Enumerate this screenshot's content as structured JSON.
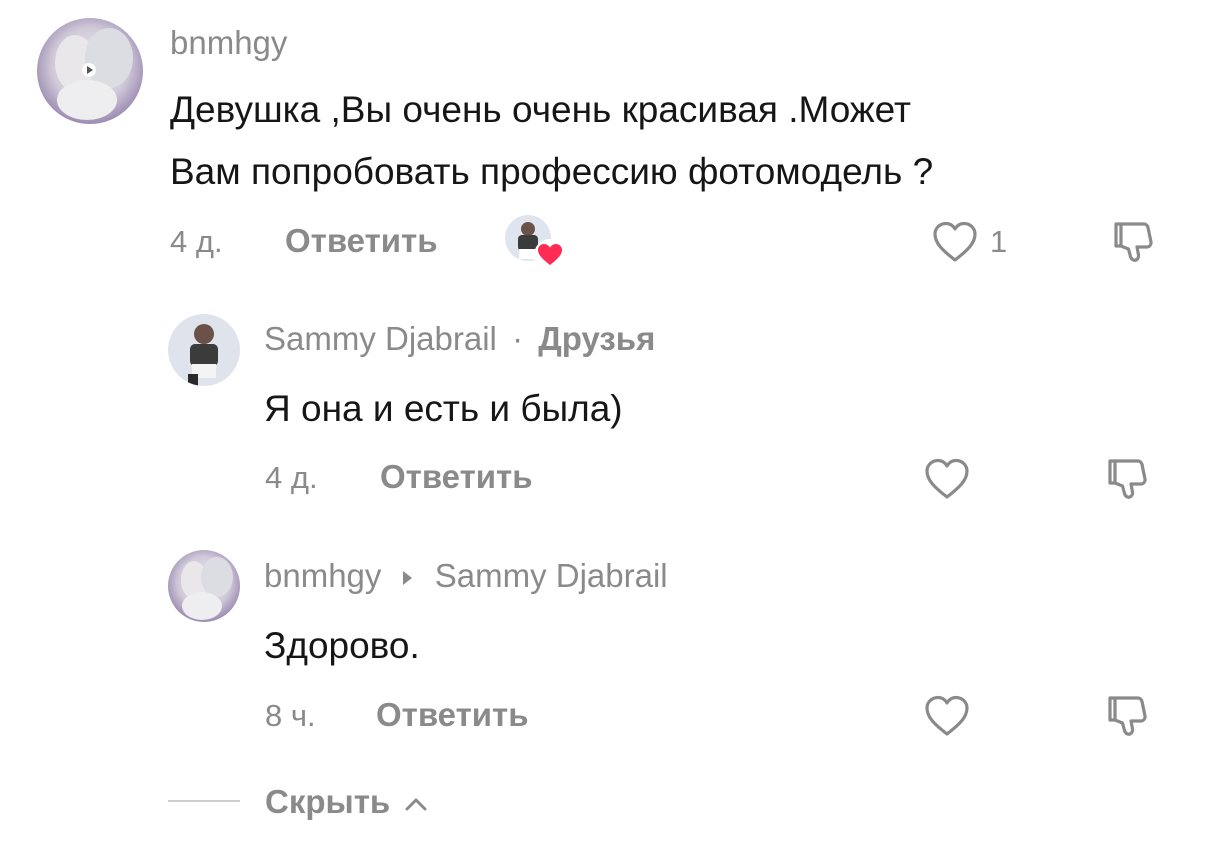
{
  "comments": [
    {
      "username": "bnmhgy",
      "text_line1": "Девушка ,Вы очень очень красивая .Может",
      "text_line2": "Вам попробовать профессию фотомодель ?",
      "time": "4 д.",
      "reply_label": "Ответить",
      "like_count": "1",
      "liked_by_creator": true
    },
    {
      "username": "Sammy Djabrail",
      "separator": "·",
      "tag": "Друзья",
      "text": "Я она и есть и была)",
      "time": "4 д.",
      "reply_label": "Ответить"
    },
    {
      "username": "bnmhgy",
      "reply_to": "Sammy Djabrail",
      "text": "Здорово.",
      "time": "8 ч.",
      "reply_label": "Ответить"
    }
  ],
  "hide_label": "Скрыть",
  "colors": {
    "text": "#161616",
    "muted": "#8a8a8a",
    "heart_badge": "#fe2c55"
  }
}
